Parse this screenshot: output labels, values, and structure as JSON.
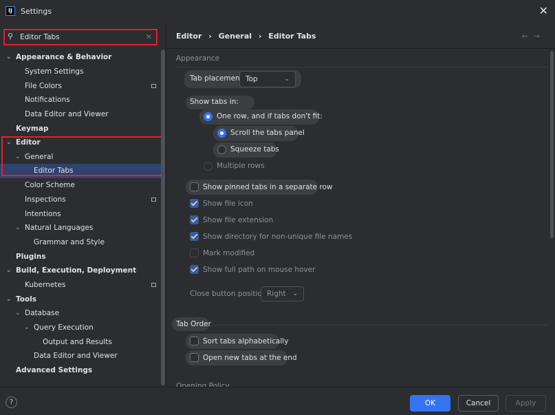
{
  "window": {
    "title": "Settings",
    "icon_label": "IJ"
  },
  "search": {
    "value": "Editor Tabs"
  },
  "sidebar": {
    "items": [
      {
        "label": "Appearance & Behavior"
      },
      {
        "label": "System Settings"
      },
      {
        "label": "File Colors"
      },
      {
        "label": "Notifications"
      },
      {
        "label": "Data Editor and Viewer"
      },
      {
        "label": "Keymap"
      },
      {
        "label": "Editor"
      },
      {
        "label": "General"
      },
      {
        "label": "Editor Tabs"
      },
      {
        "label": "Color Scheme"
      },
      {
        "label": "Inspections"
      },
      {
        "label": "Intentions"
      },
      {
        "label": "Natural Languages"
      },
      {
        "label": "Grammar and Style"
      },
      {
        "label": "Plugins"
      },
      {
        "label": "Build, Execution, Deployment"
      },
      {
        "label": "Kubernetes"
      },
      {
        "label": "Tools"
      },
      {
        "label": "Database"
      },
      {
        "label": "Query Execution"
      },
      {
        "label": "Output and Results"
      },
      {
        "label": "Data Editor and Viewer"
      },
      {
        "label": "Advanced Settings"
      }
    ]
  },
  "breadcrumb": {
    "part1": "Editor",
    "part2": "General",
    "part3": "Editor Tabs",
    "sep": "›"
  },
  "appearance": {
    "title": "Appearance",
    "tab_placement_label": "Tab placement:",
    "tab_placement_value": "Top",
    "show_tabs_in_label": "Show tabs in:",
    "one_row_label": "One row, and if tabs don't fit:",
    "scroll_label": "Scroll the tabs panel",
    "squeeze_label": "Squeeze tabs",
    "multiple_rows_label": "Multiple rows",
    "pinned_label": "Show pinned tabs in a separate row",
    "file_icon_label": "Show file icon",
    "file_ext_label": "Show file extension",
    "directory_label": "Show directory for non-unique file names",
    "mark_modified_label": "Mark modified",
    "full_path_label": "Show full path on mouse hover",
    "close_btn_label": "Close button position:",
    "close_btn_value": "Right"
  },
  "tab_order": {
    "title": "Tab Order",
    "sort_label": "Sort tabs alphabetically",
    "open_end_label": "Open new tabs at the end"
  },
  "opening_policy": {
    "title": "Opening Policy"
  },
  "footer": {
    "ok": "OK",
    "cancel": "Cancel",
    "apply": "Apply",
    "help": "?"
  },
  "colors": {
    "accent": "#3574f0",
    "highlight": "#e8202b",
    "selected": "#2e436e"
  }
}
